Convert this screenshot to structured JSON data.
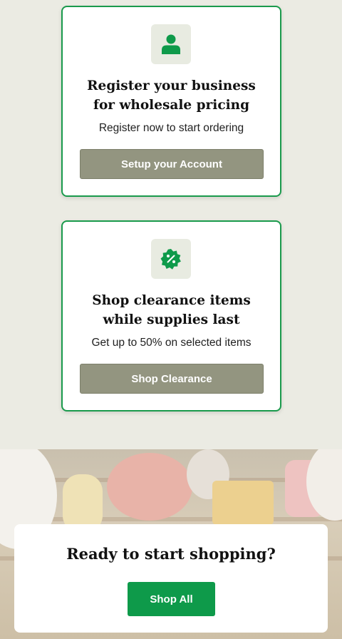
{
  "cards": [
    {
      "icon": "user-icon",
      "title_line1": "Register your business",
      "title_line2": "for wholesale pricing",
      "subtitle": "Register now to start ordering",
      "button_label": "Setup your Account"
    },
    {
      "icon": "discount-badge-icon",
      "title_line1": "Shop clearance items",
      "title_line2": "while supplies last",
      "subtitle": "Get up to 50% on selected items",
      "button_label": "Shop Clearance"
    }
  ],
  "hero": {
    "title": "Ready to start shopping?",
    "button_label": "Shop All"
  },
  "colors": {
    "page_background": "#ebebe3",
    "card_border": "#1a9a4c",
    "icon_green": "#0e9a4a",
    "secondary_button": "#939580",
    "primary_button": "#0e9a4a"
  }
}
